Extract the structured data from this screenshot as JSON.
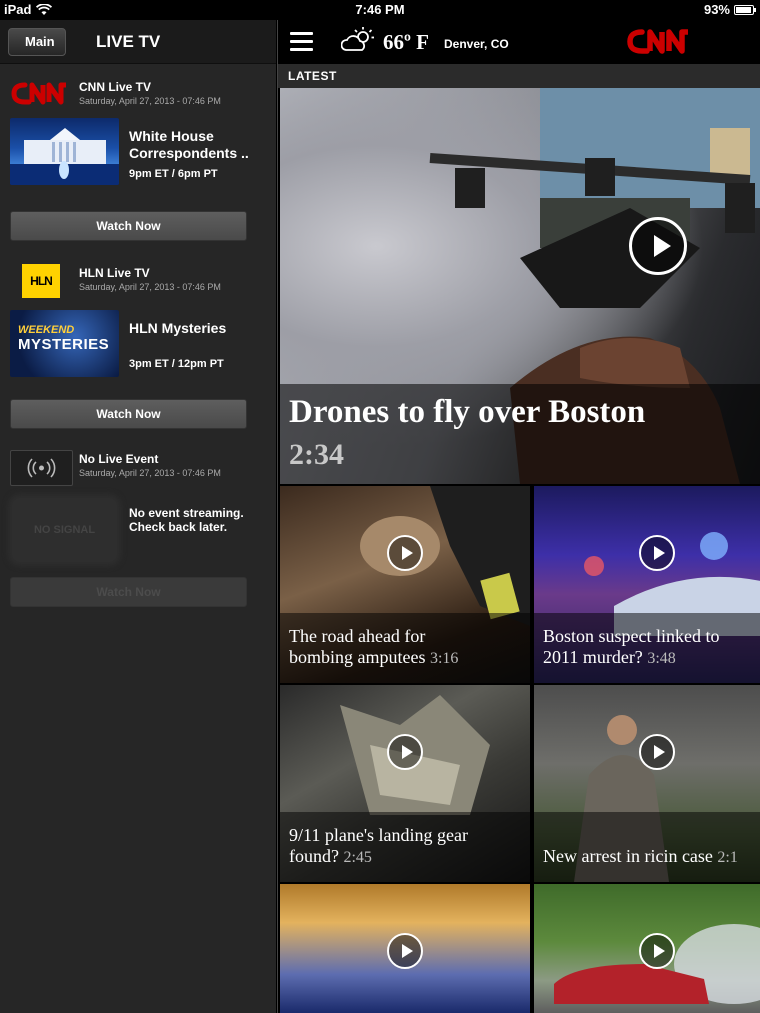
{
  "status_bar": {
    "device": "iPad",
    "time": "7:46 PM",
    "battery": "93%",
    "battery_level": 0.93
  },
  "sidebar": {
    "back_label": "Main",
    "title": "LIVE TV",
    "channels": [
      {
        "logo": "CNN",
        "name": "CNN Live TV",
        "date": "Saturday, April 27, 2013 - 07:46 PM",
        "show_title": "White House Correspondents ..",
        "show_time": "9pm ET / 6pm PT",
        "watch_label": "Watch Now"
      },
      {
        "logo": "HLN",
        "name": "HLN Live TV",
        "date": "Saturday, April 27, 2013 - 07:46 PM",
        "thumb_text_1": "WEEKEND",
        "thumb_text_2": "MYSTERIES",
        "show_title": "HLN Mysteries",
        "show_time": "3pm ET / 12pm PT",
        "watch_label": "Watch Now"
      },
      {
        "logo": "broadcast-icon",
        "name": "No Live Event",
        "date": "Saturday, April 27, 2013 - 07:46 PM",
        "thumb_text": "NO SIGNAL",
        "message": "No event streaming. Check back later.",
        "watch_label": "Watch Now"
      }
    ]
  },
  "header": {
    "temperature": "66º F",
    "location": "Denver, CO",
    "brand": "CNN"
  },
  "section": {
    "label": "LATEST"
  },
  "hero": {
    "title": "Drones to fly over Boston",
    "duration": "2:34"
  },
  "videos": [
    {
      "title": "The road ahead for\nbombing amputees",
      "duration": "3:16"
    },
    {
      "title": "Boston suspect linked to\n2011 murder?",
      "duration": "3:48"
    },
    {
      "title": "9/11 plane's landing gear\nfound?",
      "duration": "2:45"
    },
    {
      "title": "New arrest in ricin case",
      "duration": "2:1"
    },
    {
      "title": "",
      "duration": ""
    },
    {
      "title": "",
      "duration": ""
    }
  ],
  "colors": {
    "cnn_red": "#cc0000",
    "hln_yellow": "#ffd200",
    "sidebar_bg": "#262626",
    "section_bar": "#2b2b2b"
  }
}
